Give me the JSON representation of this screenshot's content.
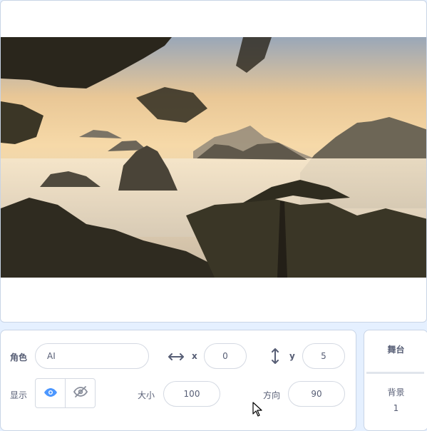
{
  "sprite_info": {
    "sprite_label": "角色",
    "sprite_name": "AI",
    "x_label": "x",
    "x_value": "0",
    "y_label": "y",
    "y_value": "5",
    "show_label": "显示",
    "size_label": "大小",
    "size_value": "100",
    "direction_label": "方向",
    "direction_value": "90"
  },
  "stage_selector": {
    "title": "舞台",
    "backdrops_label": "背景",
    "backdrops_count": "1"
  },
  "colors": {
    "accent": "#4c97ff",
    "text": "#575e75",
    "panel_border": "#c8d4e6",
    "background": "#e5f0ff"
  },
  "icons": [
    "arrows-horizontal-icon",
    "arrows-vertical-icon",
    "eye-icon",
    "eye-off-icon",
    "mouse-cursor-icon"
  ]
}
